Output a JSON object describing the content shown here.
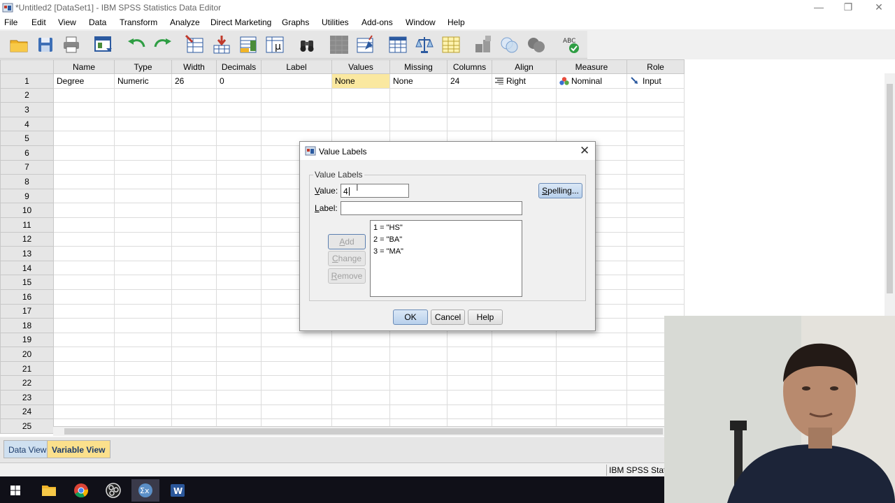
{
  "window": {
    "title": "*Untitled2 [DataSet1] - IBM SPSS Statistics Data Editor",
    "minimize": "—",
    "restore": "❐",
    "close": "✕"
  },
  "menu": [
    "File",
    "Edit",
    "View",
    "Data",
    "Transform",
    "Analyze",
    "Direct Marketing",
    "Graphs",
    "Utilities",
    "Add-ons",
    "Window",
    "Help"
  ],
  "toolbar": {
    "icons": [
      "open-folder-icon",
      "save-icon",
      "print-icon",
      "dialog-recall-icon",
      "undo-icon",
      "redo-icon",
      "goto-case-icon",
      "goto-variable-icon",
      "variables-icon",
      "value-labels-icon",
      "find-icon",
      "insert-cases-icon",
      "insert-variable-icon",
      "split-file-icon",
      "weight-cases-icon",
      "select-cases-icon",
      "value-label-toggle-icon",
      "use-sets-icon",
      "show-all-variables-icon",
      "spell-check-icon"
    ]
  },
  "grid": {
    "headers": [
      "Name",
      "Type",
      "Width",
      "Decimals",
      "Label",
      "Values",
      "Missing",
      "Columns",
      "Align",
      "Measure",
      "Role"
    ],
    "row1": {
      "number": "1",
      "name": "Degree",
      "type": "Numeric",
      "width": "26",
      "decimals": "0",
      "label": "",
      "values": "None",
      "missing": "None",
      "columns": "24",
      "align": "Right",
      "measure": "Nominal",
      "role": "Input"
    },
    "row_numbers": [
      "2",
      "3",
      "4",
      "5",
      "6",
      "7",
      "8",
      "9",
      "10",
      "11",
      "12",
      "13",
      "14",
      "15",
      "16",
      "17",
      "18",
      "19",
      "20",
      "21",
      "22",
      "23",
      "24",
      "25"
    ]
  },
  "tabs": {
    "data_view": "Data View",
    "variable_view": "Variable View"
  },
  "status": {
    "text": "IBM SPSS Statistics Processor is ready"
  },
  "taskbar": {
    "apps": [
      "windows-start-icon",
      "file-explorer-icon",
      "chrome-icon",
      "obs-icon",
      "spss-icon",
      "word-icon"
    ]
  },
  "dialog": {
    "title": "Value Labels",
    "group_label": "Value Labels",
    "value_label": "Value:",
    "value_input": "4",
    "label_label": "Label:",
    "label_input": "",
    "list": [
      "1 = \"HS\"",
      "2 = \"BA\"",
      "3 = \"MA\""
    ],
    "buttons": {
      "spelling": "Spelling...",
      "add": "Add",
      "change": "Change",
      "remove": "Remove",
      "ok": "OK",
      "cancel": "Cancel",
      "help": "Help"
    }
  }
}
